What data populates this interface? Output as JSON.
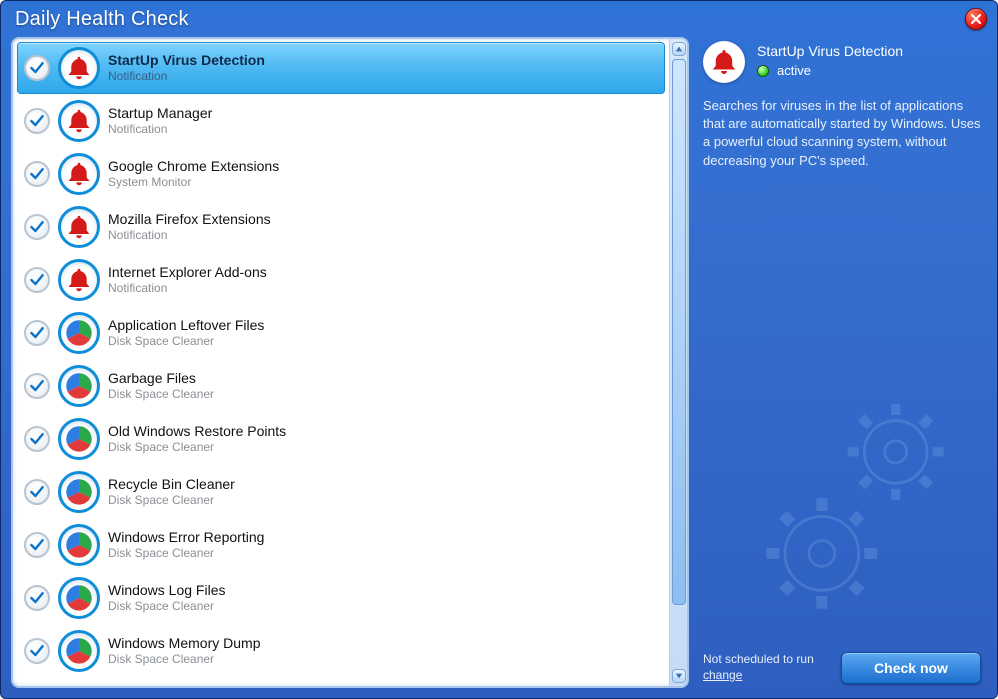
{
  "window": {
    "title": "Daily Health Check"
  },
  "items": [
    {
      "title": "StartUp Virus Detection",
      "sub": "Notification",
      "icon": "bell",
      "checked": true,
      "selected": true
    },
    {
      "title": "Startup Manager",
      "sub": "Notification",
      "icon": "bell",
      "checked": true,
      "selected": false
    },
    {
      "title": "Google Chrome Extensions",
      "sub": "System Monitor",
      "icon": "bell",
      "checked": true,
      "selected": false
    },
    {
      "title": "Mozilla Firefox Extensions",
      "sub": "Notification",
      "icon": "bell",
      "checked": true,
      "selected": false
    },
    {
      "title": "Internet Explorer Add-ons",
      "sub": "Notification",
      "icon": "bell",
      "checked": true,
      "selected": false
    },
    {
      "title": "Application Leftover Files",
      "sub": "Disk Space Cleaner",
      "icon": "pie",
      "checked": true,
      "selected": false
    },
    {
      "title": "Garbage Files",
      "sub": "Disk Space Cleaner",
      "icon": "pie",
      "checked": true,
      "selected": false
    },
    {
      "title": "Old Windows Restore Points",
      "sub": "Disk Space Cleaner",
      "icon": "pie",
      "checked": true,
      "selected": false
    },
    {
      "title": "Recycle Bin Cleaner",
      "sub": "Disk Space Cleaner",
      "icon": "pie",
      "checked": true,
      "selected": false
    },
    {
      "title": "Windows Error Reporting",
      "sub": "Disk Space Cleaner",
      "icon": "pie",
      "checked": true,
      "selected": false
    },
    {
      "title": "Windows Log Files",
      "sub": "Disk Space Cleaner",
      "icon": "pie",
      "checked": true,
      "selected": false
    },
    {
      "title": "Windows Memory Dump",
      "sub": "Disk Space Cleaner",
      "icon": "pie",
      "checked": true,
      "selected": false
    }
  ],
  "detail": {
    "title": "StartUp Virus Detection",
    "status_label": "active",
    "description": "Searches for viruses in the list of applications that are automatically started by Windows. Uses a powerful cloud scanning system, without decreasing your PC's speed."
  },
  "footer": {
    "schedule_line1": "Not scheduled to run",
    "schedule_change": "change",
    "check_now": "Check now"
  }
}
